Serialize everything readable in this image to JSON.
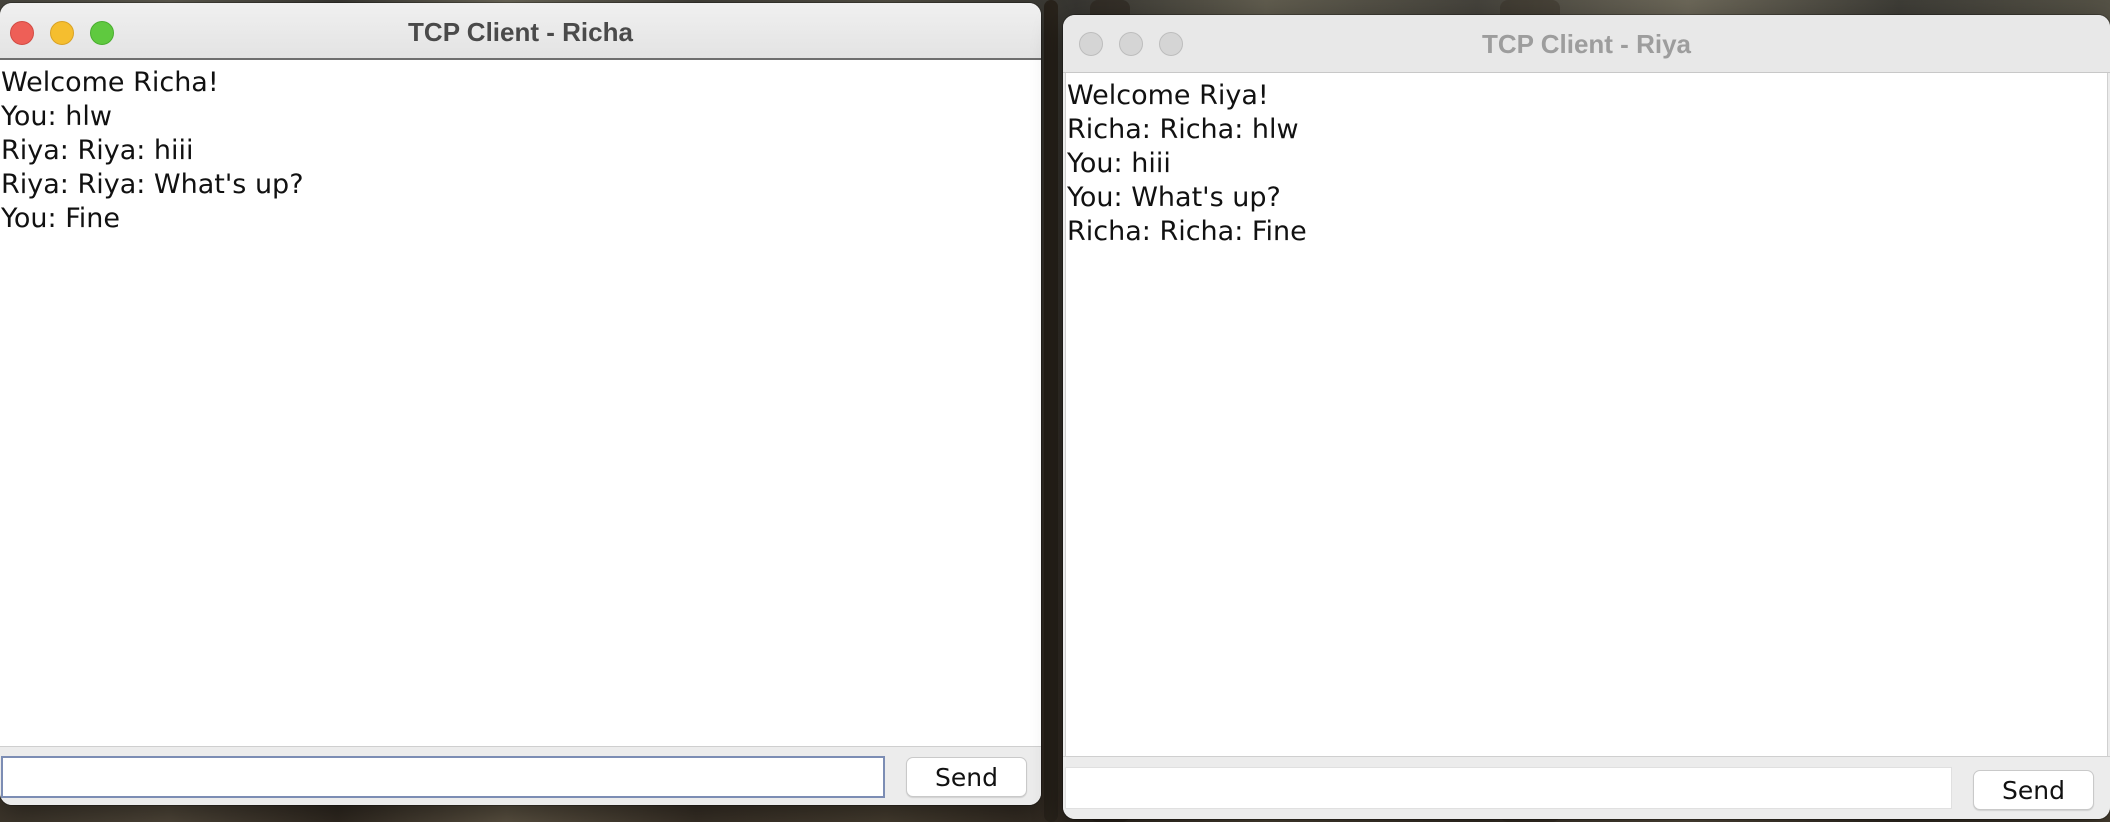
{
  "windows": [
    {
      "title": "TCP Client - Richa",
      "messages": [
        "Welcome Richa!",
        "You: hlw",
        "Riya: Riya: hiii",
        "Riya: Riya: What's up?",
        "You: Fine"
      ],
      "input_value": "",
      "send_label": "Send",
      "active": true
    },
    {
      "title": "TCP Client - Riya",
      "messages": [
        "Welcome Riya!",
        "Richa: Richa: hlw",
        "You: hiii",
        "You: What's up?",
        "Richa: Richa: Fine"
      ],
      "input_value": "",
      "send_label": "Send",
      "active": false
    }
  ],
  "colors": {
    "close": "#ee5f57",
    "minimize": "#f5be2f",
    "zoom": "#5fc93f",
    "inactive_light": "#d5d5d5",
    "input_focus_border": "#7c8db4"
  }
}
